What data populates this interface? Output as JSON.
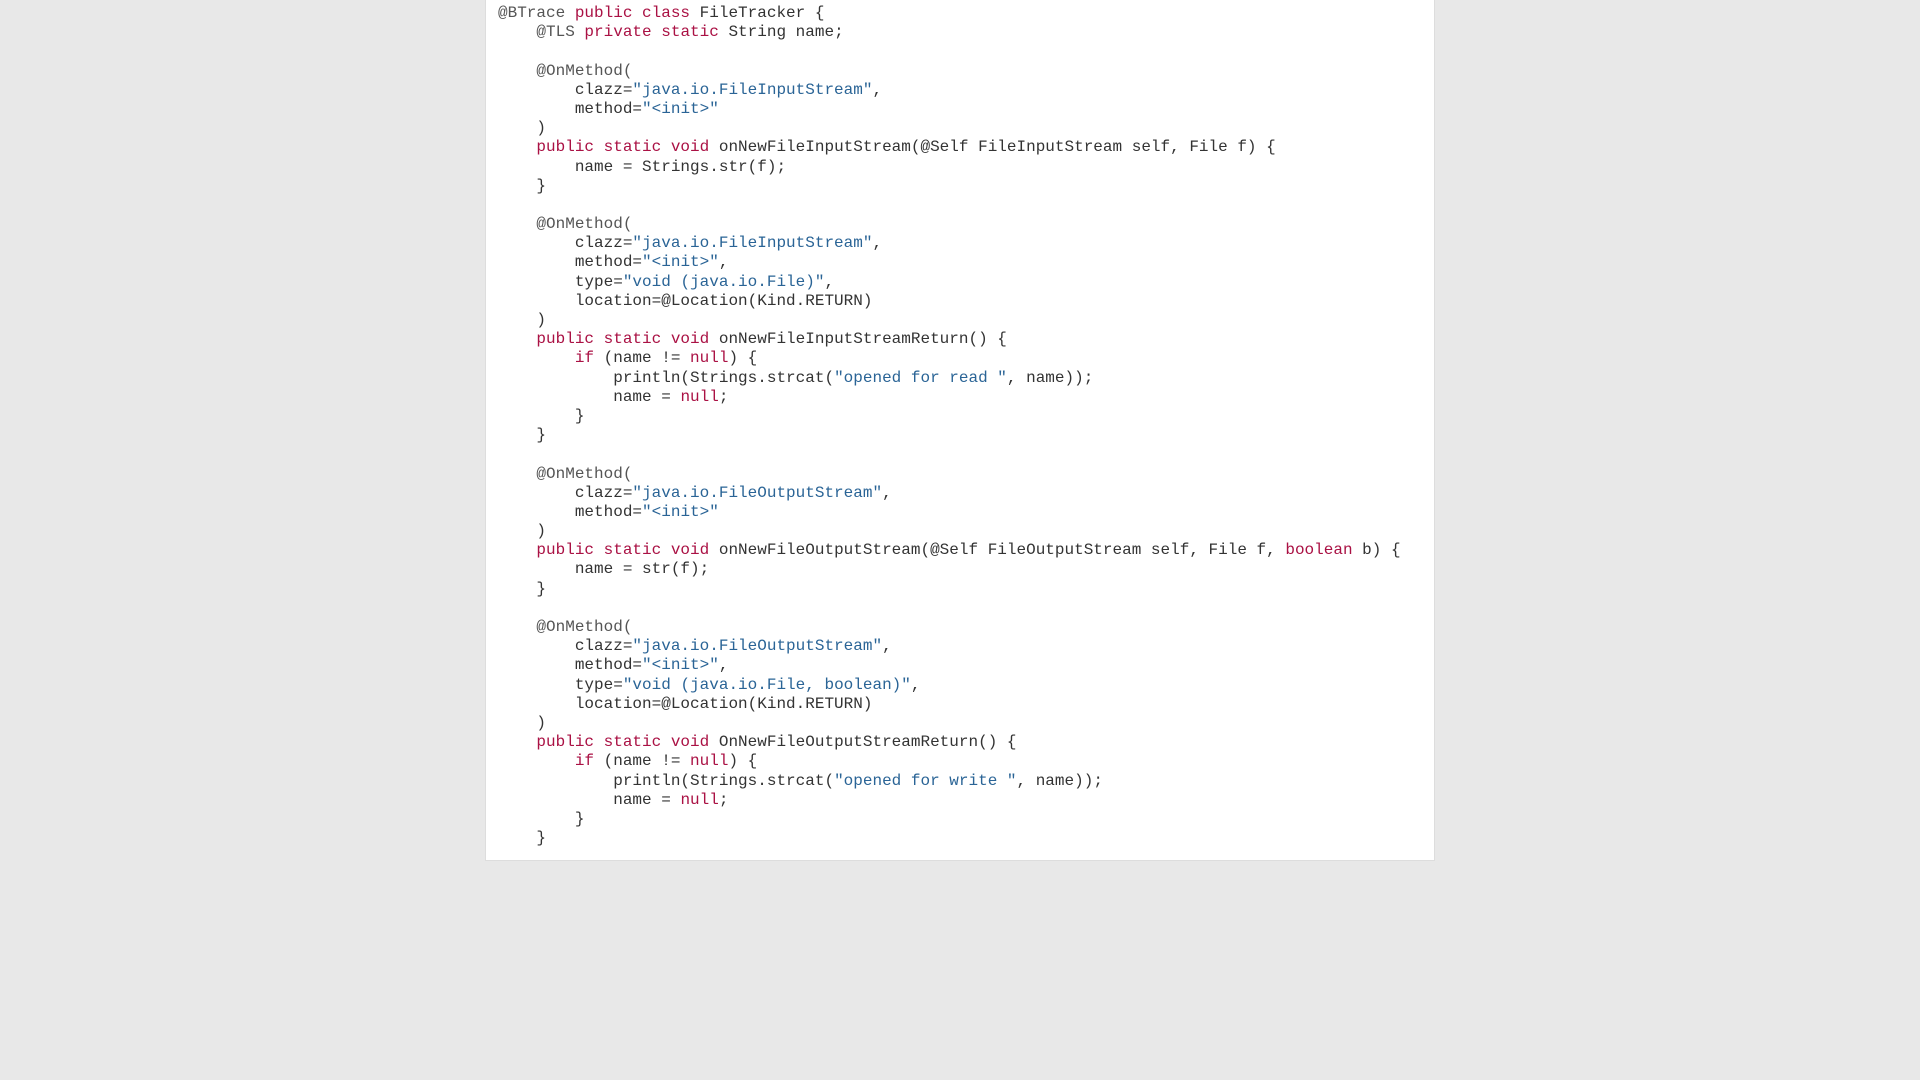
{
  "code": {
    "tokens": [
      [
        [
          "ann",
          "@BTrace "
        ],
        [
          "kw",
          "public class "
        ],
        [
          "plain",
          "FileTracker {"
        ]
      ],
      [
        [
          "plain",
          "    "
        ],
        [
          "ann",
          "@TLS "
        ],
        [
          "kw",
          "private static "
        ],
        [
          "plain",
          "String name;"
        ]
      ],
      [
        [
          "plain",
          ""
        ]
      ],
      [
        [
          "plain",
          "    "
        ],
        [
          "ann",
          "@OnMethod("
        ]
      ],
      [
        [
          "plain",
          "        clazz="
        ],
        [
          "str",
          "\"java.io.FileInputStream\""
        ],
        [
          "plain",
          ","
        ]
      ],
      [
        [
          "plain",
          "        method="
        ],
        [
          "str",
          "\"<init>\""
        ]
      ],
      [
        [
          "plain",
          "    )"
        ]
      ],
      [
        [
          "plain",
          "    "
        ],
        [
          "kw",
          "public static void "
        ],
        [
          "plain",
          "onNewFileInputStream(@Self FileInputStream self, File f) {"
        ]
      ],
      [
        [
          "plain",
          "        name = Strings.str(f);"
        ]
      ],
      [
        [
          "plain",
          "    }"
        ]
      ],
      [
        [
          "plain",
          ""
        ]
      ],
      [
        [
          "plain",
          "    "
        ],
        [
          "ann",
          "@OnMethod("
        ]
      ],
      [
        [
          "plain",
          "        clazz="
        ],
        [
          "str",
          "\"java.io.FileInputStream\""
        ],
        [
          "plain",
          ","
        ]
      ],
      [
        [
          "plain",
          "        method="
        ],
        [
          "str",
          "\"<init>\""
        ],
        [
          "plain",
          ","
        ]
      ],
      [
        [
          "plain",
          "        type="
        ],
        [
          "str",
          "\"void (java.io.File)\""
        ],
        [
          "plain",
          ","
        ]
      ],
      [
        [
          "plain",
          "        location=@Location(Kind.RETURN)"
        ]
      ],
      [
        [
          "plain",
          "    )"
        ]
      ],
      [
        [
          "plain",
          "    "
        ],
        [
          "kw",
          "public static void "
        ],
        [
          "plain",
          "onNewFileInputStreamReturn() {"
        ]
      ],
      [
        [
          "plain",
          "        "
        ],
        [
          "kw",
          "if "
        ],
        [
          "plain",
          "(name != "
        ],
        [
          "bool",
          "null"
        ],
        [
          "plain",
          ") {"
        ]
      ],
      [
        [
          "plain",
          "            println(Strings.strcat("
        ],
        [
          "str",
          "\"opened for read \""
        ],
        [
          "plain",
          ", name));"
        ]
      ],
      [
        [
          "plain",
          "            name = "
        ],
        [
          "bool",
          "null"
        ],
        [
          "plain",
          ";"
        ]
      ],
      [
        [
          "plain",
          "        }"
        ]
      ],
      [
        [
          "plain",
          "    }"
        ]
      ],
      [
        [
          "plain",
          ""
        ]
      ],
      [
        [
          "plain",
          "    "
        ],
        [
          "ann",
          "@OnMethod("
        ]
      ],
      [
        [
          "plain",
          "        clazz="
        ],
        [
          "str",
          "\"java.io.FileOutputStream\""
        ],
        [
          "plain",
          ","
        ]
      ],
      [
        [
          "plain",
          "        method="
        ],
        [
          "str",
          "\"<init>\""
        ]
      ],
      [
        [
          "plain",
          "    )"
        ]
      ],
      [
        [
          "plain",
          "    "
        ],
        [
          "kw",
          "public static void "
        ],
        [
          "plain",
          "onNewFileOutputStream(@Self FileOutputStream self, File f, "
        ],
        [
          "kw",
          "boolean"
        ],
        [
          "plain",
          " b) {"
        ]
      ],
      [
        [
          "plain",
          "        name = str(f);"
        ]
      ],
      [
        [
          "plain",
          "    }"
        ]
      ],
      [
        [
          "plain",
          ""
        ]
      ],
      [
        [
          "plain",
          "    "
        ],
        [
          "ann",
          "@OnMethod("
        ]
      ],
      [
        [
          "plain",
          "        clazz="
        ],
        [
          "str",
          "\"java.io.FileOutputStream\""
        ],
        [
          "plain",
          ","
        ]
      ],
      [
        [
          "plain",
          "        method="
        ],
        [
          "str",
          "\"<init>\""
        ],
        [
          "plain",
          ","
        ]
      ],
      [
        [
          "plain",
          "        type="
        ],
        [
          "str",
          "\"void (java.io.File, boolean)\""
        ],
        [
          "plain",
          ","
        ]
      ],
      [
        [
          "plain",
          "        location=@Location(Kind.RETURN)"
        ]
      ],
      [
        [
          "plain",
          "    )"
        ]
      ],
      [
        [
          "plain",
          "    "
        ],
        [
          "kw",
          "public static void "
        ],
        [
          "plain",
          "OnNewFileOutputStreamReturn() {"
        ]
      ],
      [
        [
          "plain",
          "        "
        ],
        [
          "kw",
          "if "
        ],
        [
          "plain",
          "(name != "
        ],
        [
          "bool",
          "null"
        ],
        [
          "plain",
          ") {"
        ]
      ],
      [
        [
          "plain",
          "            println(Strings.strcat("
        ],
        [
          "str",
          "\"opened for write \""
        ],
        [
          "plain",
          ", name));"
        ]
      ],
      [
        [
          "plain",
          "            name = "
        ],
        [
          "bool",
          "null"
        ],
        [
          "plain",
          ";"
        ]
      ],
      [
        [
          "plain",
          "        }"
        ]
      ],
      [
        [
          "plain",
          "    }"
        ]
      ]
    ]
  }
}
